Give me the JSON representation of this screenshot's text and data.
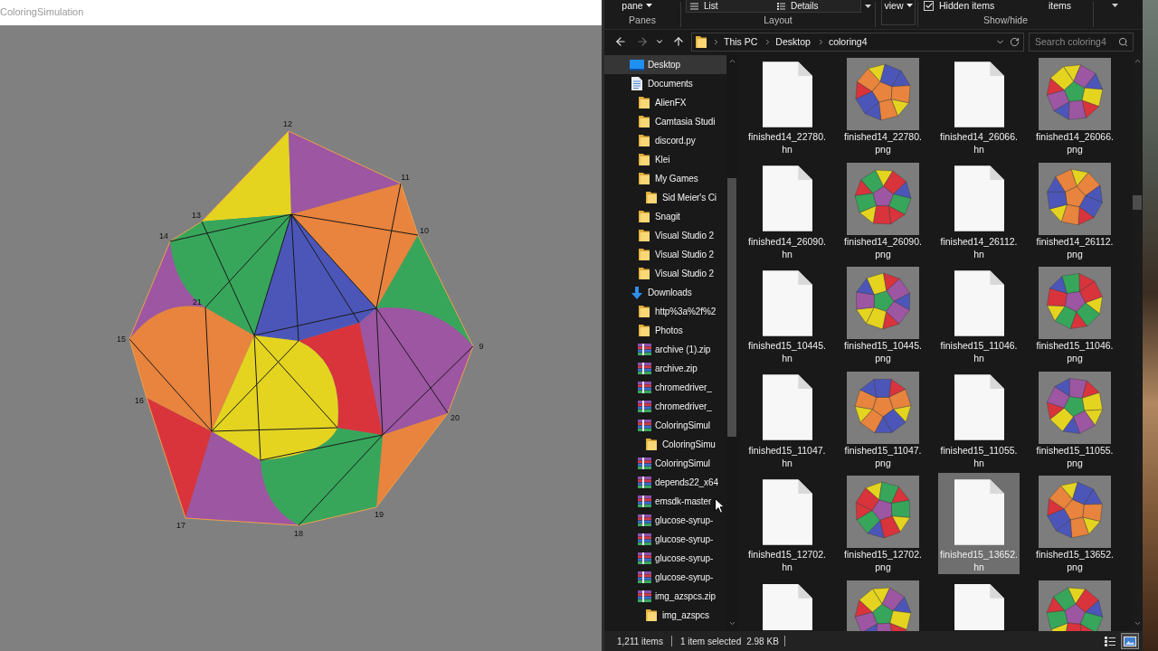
{
  "app_window": {
    "title": "ColoringSimulation",
    "canvas": {
      "faces": [
        {
          "color": "#e4d420"
        },
        {
          "color": "#9c56a2"
        },
        {
          "color": "#e8843d"
        },
        {
          "color": "#37a65b"
        },
        {
          "color": "#9c56a2"
        },
        {
          "color": "#e8843d"
        },
        {
          "color": "#37a65b"
        },
        {
          "color": "#9c56a2"
        },
        {
          "color": "#d9333c"
        },
        {
          "color": "#e8843d"
        },
        {
          "color": "#9c56a2"
        },
        {
          "color": "#37a65b"
        },
        {
          "color": "#4c56b9"
        },
        {
          "color": "#d9333c"
        },
        {
          "color": "#e4d420"
        }
      ],
      "node_labels": [
        "12",
        "11",
        "10",
        "9",
        "20",
        "19",
        "18",
        "17",
        "16",
        "15",
        "14",
        "13",
        "21"
      ]
    }
  },
  "ribbon": {
    "panes": {
      "button": "pane",
      "label": "Panes"
    },
    "layout": {
      "options": [
        {
          "label": "List",
          "kind": "list"
        },
        {
          "label": "Details",
          "kind": "details"
        }
      ],
      "label": "Layout"
    },
    "current_view": {
      "button": "view"
    },
    "show_hide": {
      "checkboxes": [
        {
          "label": "Hidden items",
          "checked": true
        }
      ],
      "button": "items",
      "label": "Show/hide"
    }
  },
  "address_bar": {
    "nav_buttons": [
      {
        "kind": "back",
        "disabled": false
      },
      {
        "kind": "forward",
        "disabled": true
      },
      {
        "kind": "recent",
        "disabled": false
      },
      {
        "kind": "up",
        "disabled": false
      }
    ],
    "breadcrumb": [
      "This PC",
      "Desktop",
      "coloring4"
    ]
  },
  "search": {
    "placeholder": "Search coloring4"
  },
  "navigation_pane": {
    "items": [
      {
        "label": "Desktop",
        "kind": "desktop",
        "selected": true
      },
      {
        "label": "Documents",
        "kind": "documents",
        "selected": false,
        "children": [
          {
            "label": "AlienFX",
            "kind": "folder",
            "selected": false
          },
          {
            "label": "Camtasia Studi",
            "kind": "folder",
            "selected": false
          },
          {
            "label": "discord.py",
            "kind": "folder",
            "selected": false
          },
          {
            "label": "Klei",
            "kind": "folder",
            "selected": false
          },
          {
            "label": "My Games",
            "kind": "folder",
            "selected": false,
            "children": [
              {
                "label": "Sid Meier's Ci",
                "kind": "folder",
                "selected": false
              }
            ]
          },
          {
            "label": "Snagit",
            "kind": "folder",
            "selected": false
          },
          {
            "label": "Visual Studio 2",
            "kind": "folder",
            "selected": false
          },
          {
            "label": "Visual Studio 2",
            "kind": "folder",
            "selected": false
          },
          {
            "label": "Visual Studio 2",
            "kind": "folder",
            "selected": false
          }
        ]
      },
      {
        "label": "Downloads",
        "kind": "downloads",
        "selected": false,
        "children": [
          {
            "label": "http%3a%2f%2",
            "kind": "folder",
            "selected": false
          },
          {
            "label": "Photos",
            "kind": "folder",
            "selected": false
          },
          {
            "label": "archive (1).zip",
            "kind": "archive",
            "selected": false
          },
          {
            "label": "archive.zip",
            "kind": "archive",
            "selected": false
          },
          {
            "label": "chromedriver_",
            "kind": "archive",
            "selected": false
          },
          {
            "label": "chromedriver_",
            "kind": "archive",
            "selected": false
          },
          {
            "label": "ColoringSimul",
            "kind": "archive",
            "selected": false,
            "children": [
              {
                "label": "ColoringSimu",
                "kind": "folder",
                "selected": false
              }
            ]
          },
          {
            "label": "ColoringSimul",
            "kind": "archive",
            "selected": false
          },
          {
            "label": "depends22_x64",
            "kind": "archive",
            "selected": false
          },
          {
            "label": "emsdk-master",
            "kind": "archive",
            "selected": false
          },
          {
            "label": "glucose-syrup-",
            "kind": "archive",
            "selected": false
          },
          {
            "label": "glucose-syrup-",
            "kind": "archive",
            "selected": false
          },
          {
            "label": "glucose-syrup-",
            "kind": "archive",
            "selected": false
          },
          {
            "label": "glucose-syrup-",
            "kind": "archive",
            "selected": false
          },
          {
            "label": "img_azspcs.zip",
            "kind": "archive",
            "selected": false,
            "children": [
              {
                "label": "img_azspcs",
                "kind": "folder",
                "selected": false
              }
            ]
          }
        ]
      }
    ]
  },
  "files": [
    {
      "name": "finished14_22780.hn",
      "kind": "hn",
      "selected": false
    },
    {
      "name": "finished14_22780.png",
      "kind": "png",
      "selected": false
    },
    {
      "name": "finished14_26066.hn",
      "kind": "hn",
      "selected": false
    },
    {
      "name": "finished14_26066.png",
      "kind": "png",
      "selected": false
    },
    {
      "name": "finished14_26090.hn",
      "kind": "hn",
      "selected": false
    },
    {
      "name": "finished14_26090.png",
      "kind": "png",
      "selected": false
    },
    {
      "name": "finished14_26112.hn",
      "kind": "hn",
      "selected": false
    },
    {
      "name": "finished14_26112.png",
      "kind": "png",
      "selected": false
    },
    {
      "name": "finished15_10445.hn",
      "kind": "hn",
      "selected": false
    },
    {
      "name": "finished15_10445.png",
      "kind": "png",
      "selected": false
    },
    {
      "name": "finished15_11046.hn",
      "kind": "hn",
      "selected": false
    },
    {
      "name": "finished15_11046.png",
      "kind": "png",
      "selected": false
    },
    {
      "name": "finished15_11047.hn",
      "kind": "hn",
      "selected": false
    },
    {
      "name": "finished15_11047.png",
      "kind": "png",
      "selected": false
    },
    {
      "name": "finished15_11055.hn",
      "kind": "hn",
      "selected": false
    },
    {
      "name": "finished15_11055.png",
      "kind": "png",
      "selected": false
    },
    {
      "name": "finished15_12702.hn",
      "kind": "hn",
      "selected": false
    },
    {
      "name": "finished15_12702.png",
      "kind": "png",
      "selected": false
    },
    {
      "name": "finished15_13652.hn",
      "kind": "hn",
      "selected": true
    },
    {
      "name": "finished15_13652.png",
      "kind": "png",
      "selected": false
    },
    {
      "kind": "hn",
      "selected": false,
      "cut_off": true
    },
    {
      "kind": "png",
      "selected": false,
      "cut_off": true
    },
    {
      "kind": "hn",
      "selected": false,
      "cut_off": true
    },
    {
      "kind": "png",
      "selected": false,
      "cut_off": true
    }
  ],
  "status_bar": {
    "item_count": "1,211 items",
    "selection": "1 item selected",
    "size": "2.98 KB",
    "view_modes": [
      {
        "kind": "details",
        "selected": false
      },
      {
        "kind": "large_icons",
        "selected": true
      }
    ]
  }
}
